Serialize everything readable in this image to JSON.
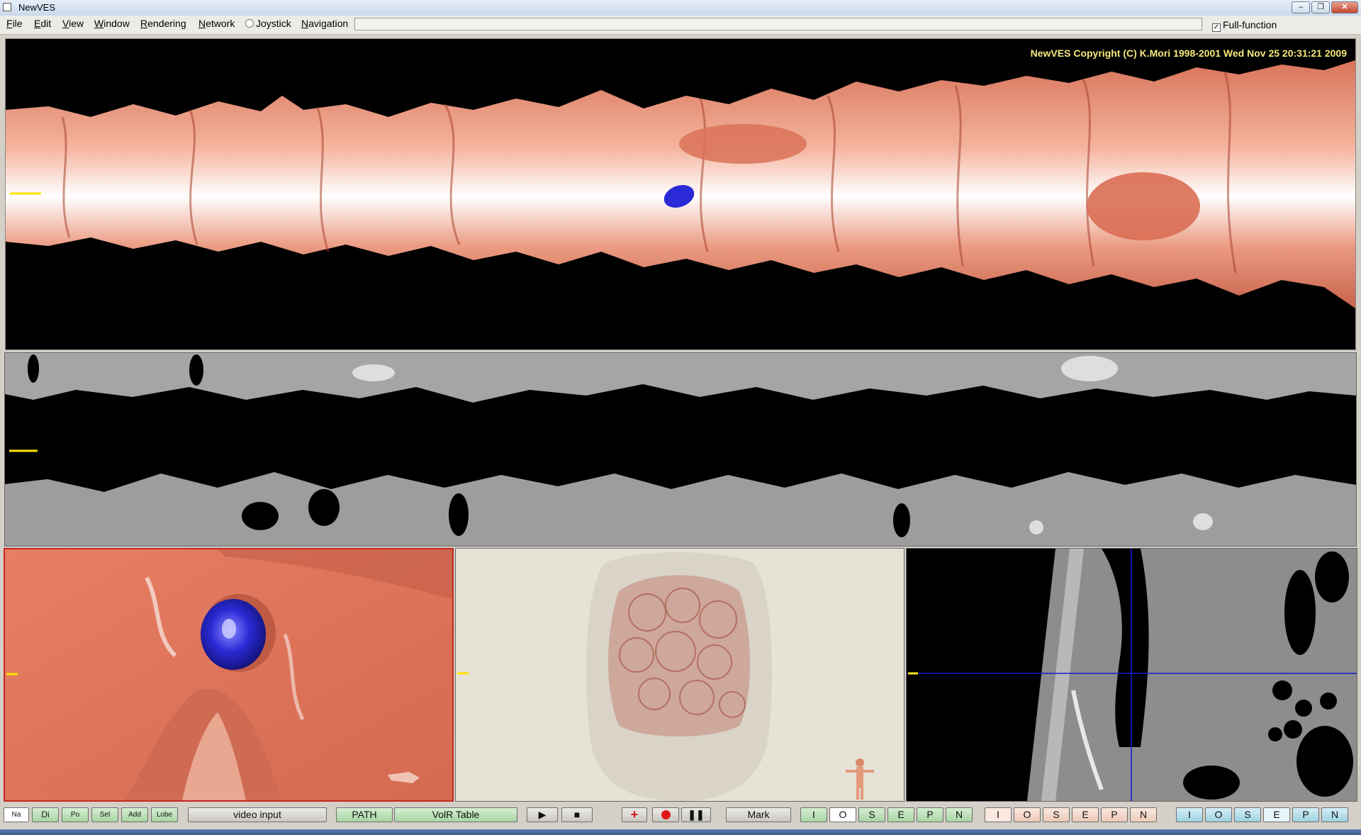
{
  "window": {
    "title": "NewVES"
  },
  "menu": {
    "items": [
      "File",
      "Edit",
      "View",
      "Window",
      "Rendering",
      "Network",
      "Joystick",
      "Navigation"
    ],
    "full_function_label": "Full-function",
    "full_function_checked": true
  },
  "top_view": {
    "copyright": "NewVES Copyright (C) K.Mori 1998-2001 Wed Nov 25 20:31:21 2009"
  },
  "toolbar": {
    "left_buttons": [
      "Na",
      "Di",
      "Po",
      "Sel",
      "Add",
      "Lobe"
    ],
    "video_input": "video input",
    "path": "PATH",
    "volr_table": "VolR Table",
    "mark": "Mark",
    "group1": [
      "I",
      "O",
      "S",
      "E",
      "P",
      "N"
    ],
    "group2": [
      "I",
      "O",
      "S",
      "E",
      "P",
      "N"
    ],
    "group3": [
      "I",
      "O",
      "S",
      "E",
      "P",
      "N"
    ]
  },
  "colors": {
    "tissue": "#e47d63",
    "polyp": "#2a2ad6",
    "marker": "#ffe400",
    "crosshair": "#1a1ad8"
  }
}
